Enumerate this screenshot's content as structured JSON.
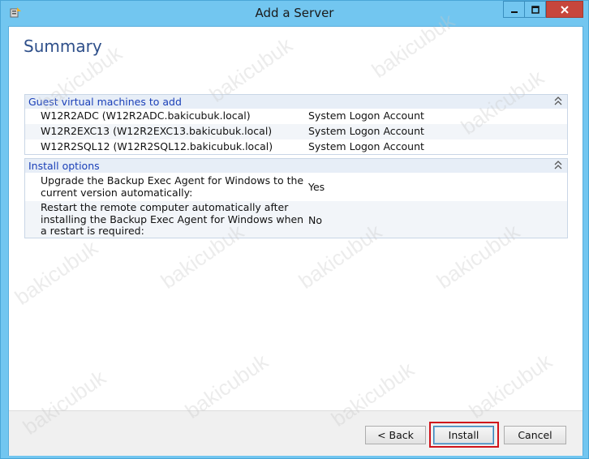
{
  "window": {
    "title": "Add a Server",
    "minimize_icon": "minimize-icon",
    "maximize_icon": "maximize-icon",
    "close_icon": "close-icon"
  },
  "page": {
    "heading": "Summary"
  },
  "guest_section": {
    "title": "Guest virtual machines to add",
    "rows": [
      {
        "name": "W12R2ADC (W12R2ADC.bakicubuk.local)",
        "account": "System Logon Account"
      },
      {
        "name": "W12R2EXC13 (W12R2EXC13.bakicubuk.local)",
        "account": "System Logon Account"
      },
      {
        "name": "W12R2SQL12 (W12R2SQL12.bakicubuk.local)",
        "account": "System Logon Account"
      }
    ]
  },
  "install_section": {
    "title": "Install options",
    "rows": [
      {
        "option_line1": "Upgrade the Backup Exec Agent for Windows to the",
        "option_line2": "current version automatically:",
        "value": "Yes"
      },
      {
        "option_line1": "Restart the remote computer automatically after",
        "option_line2": "installing the Backup Exec Agent for Windows when",
        "option_line3": "a restart is required:",
        "value": "No"
      }
    ]
  },
  "buttons": {
    "back": "< Back",
    "install": "Install",
    "cancel": "Cancel"
  },
  "watermark": "bakicubuk",
  "colors": {
    "titlebar": "#72c6f0",
    "heading": "#2e4f8a",
    "section_title": "#1a3fb8",
    "highlight": "#d0141b"
  }
}
